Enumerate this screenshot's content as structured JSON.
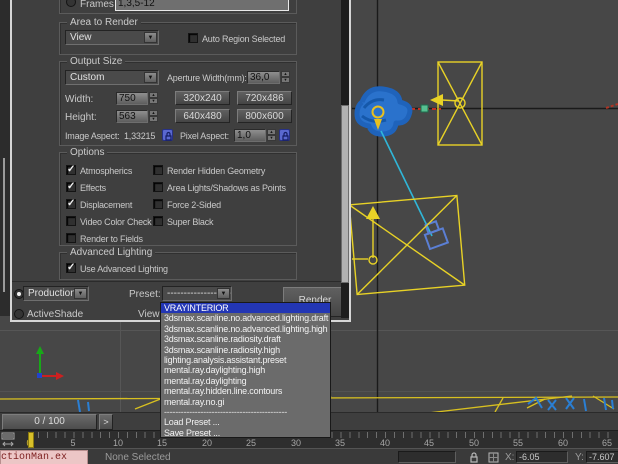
{
  "glyphs": {
    "check": "✓",
    "up": "▲",
    "down": "▼"
  },
  "colors": {
    "dialog_bg": "#3f3f3f",
    "viewport_bg": "#474747",
    "selection_blue": "#2336b4",
    "wireframe_yellow": "#e8d226",
    "selected_object_blue": "#2a72cc",
    "target_line_cyan": "#30b6d8",
    "camera_blue": "#5b7fd4",
    "axis_green": "#18a818",
    "axis_red": "#cc2020",
    "time_slider_yellow": "#d8c02a",
    "taskbar_chip_pink": "#ecc6c6"
  },
  "dialog": {
    "frames": {
      "label": "Frames",
      "value": "1,3,5-12"
    },
    "area_to_render": {
      "title": "Area to Render",
      "dropdown_value": "View",
      "auto_region_label": "Auto Region Selected",
      "auto_region_checked": false
    },
    "output_size": {
      "title": "Output Size",
      "dropdown_value": "Custom",
      "aperture_label": "Aperture Width(mm):",
      "aperture_value": "36,0",
      "width_label": "Width:",
      "width_value": "750",
      "height_label": "Height:",
      "height_value": "563",
      "size_presets": [
        "320x240",
        "720x486",
        "640x480",
        "800x600"
      ],
      "image_aspect_label": "Image Aspect:",
      "image_aspect_value": "1,33215",
      "pixel_aspect_label": "Pixel Aspect:",
      "pixel_aspect_value": "1,0"
    },
    "options": {
      "title": "Options",
      "column1": [
        {
          "label": "Atmospherics",
          "checked": true
        },
        {
          "label": "Effects",
          "checked": true
        },
        {
          "label": "Displacement",
          "checked": true
        },
        {
          "label": "Video Color Check",
          "checked": false
        },
        {
          "label": "Render to Fields",
          "checked": false
        }
      ],
      "column2": [
        {
          "label": "Render Hidden Geometry",
          "checked": false
        },
        {
          "label": "Area Lights/Shadows as Points",
          "checked": false
        },
        {
          "label": "Force 2-Sided",
          "checked": false
        },
        {
          "label": "Super Black",
          "checked": false
        }
      ]
    },
    "advanced_lighting": {
      "title": "Advanced Lighting",
      "use_label": "Use Advanced Lighting",
      "use_checked": true
    },
    "footer": {
      "production_value": "Production",
      "production_selected": true,
      "activeshade_label": "ActiveShade",
      "activeshade_selected": false,
      "preset_label": "Preset:",
      "preset_value": "--------------------",
      "view_label": "View:",
      "render_button": "Render"
    }
  },
  "preset_dropdown": {
    "selected_index": 0,
    "items": [
      "VRAYINTERIOR",
      "3dsmax.scanline.no.advanced.lighting.draft",
      "3dsmax.scanline.no.advanced.lighting.high",
      "3dsmax.scanline.radiosity.draft",
      "3dsmax.scanline.radiosity.high",
      "lighting.analysis.assistant.preset",
      "mental.ray.daylighting.high",
      "mental.ray.daylighting",
      "mental.ray.hidden.line.contours",
      "mental.ray.no.gi"
    ],
    "separator": "--------------------------------------------",
    "actions": [
      "Load Preset ...",
      "Save Preset ..."
    ]
  },
  "timeline": {
    "frame_indicator": "0 / 100",
    "next_button": ">",
    "ticks": [
      "0",
      "5",
      "10",
      "15",
      "20",
      "25",
      "30",
      "35",
      "40",
      "45",
      "50",
      "55",
      "60",
      "65"
    ]
  },
  "statusbar": {
    "taskbar_item": "ctionMan.ex",
    "selection_status": "None Selected",
    "x_label": "X:",
    "x_value": "-6.05",
    "y_label": "Y:",
    "y_value": "-7.607"
  }
}
